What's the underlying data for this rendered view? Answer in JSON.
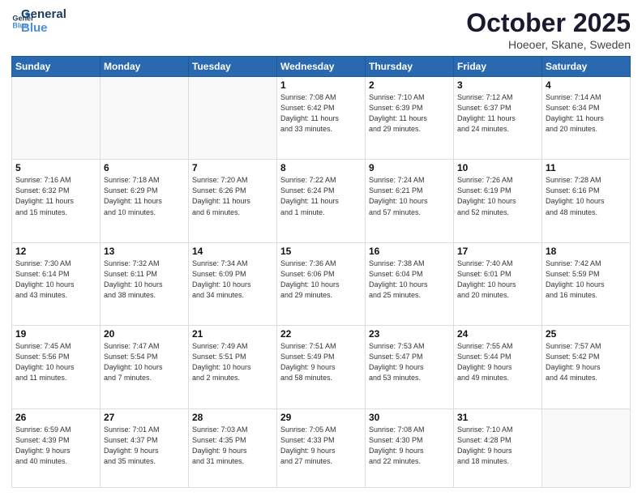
{
  "logo": {
    "line1": "General",
    "line2": "Blue"
  },
  "title": "October 2025",
  "subtitle": "Hoeoer, Skane, Sweden",
  "weekdays": [
    "Sunday",
    "Monday",
    "Tuesday",
    "Wednesday",
    "Thursday",
    "Friday",
    "Saturday"
  ],
  "weeks": [
    [
      {
        "day": "",
        "info": ""
      },
      {
        "day": "",
        "info": ""
      },
      {
        "day": "",
        "info": ""
      },
      {
        "day": "1",
        "info": "Sunrise: 7:08 AM\nSunset: 6:42 PM\nDaylight: 11 hours\nand 33 minutes."
      },
      {
        "day": "2",
        "info": "Sunrise: 7:10 AM\nSunset: 6:39 PM\nDaylight: 11 hours\nand 29 minutes."
      },
      {
        "day": "3",
        "info": "Sunrise: 7:12 AM\nSunset: 6:37 PM\nDaylight: 11 hours\nand 24 minutes."
      },
      {
        "day": "4",
        "info": "Sunrise: 7:14 AM\nSunset: 6:34 PM\nDaylight: 11 hours\nand 20 minutes."
      }
    ],
    [
      {
        "day": "5",
        "info": "Sunrise: 7:16 AM\nSunset: 6:32 PM\nDaylight: 11 hours\nand 15 minutes."
      },
      {
        "day": "6",
        "info": "Sunrise: 7:18 AM\nSunset: 6:29 PM\nDaylight: 11 hours\nand 10 minutes."
      },
      {
        "day": "7",
        "info": "Sunrise: 7:20 AM\nSunset: 6:26 PM\nDaylight: 11 hours\nand 6 minutes."
      },
      {
        "day": "8",
        "info": "Sunrise: 7:22 AM\nSunset: 6:24 PM\nDaylight: 11 hours\nand 1 minute."
      },
      {
        "day": "9",
        "info": "Sunrise: 7:24 AM\nSunset: 6:21 PM\nDaylight: 10 hours\nand 57 minutes."
      },
      {
        "day": "10",
        "info": "Sunrise: 7:26 AM\nSunset: 6:19 PM\nDaylight: 10 hours\nand 52 minutes."
      },
      {
        "day": "11",
        "info": "Sunrise: 7:28 AM\nSunset: 6:16 PM\nDaylight: 10 hours\nand 48 minutes."
      }
    ],
    [
      {
        "day": "12",
        "info": "Sunrise: 7:30 AM\nSunset: 6:14 PM\nDaylight: 10 hours\nand 43 minutes."
      },
      {
        "day": "13",
        "info": "Sunrise: 7:32 AM\nSunset: 6:11 PM\nDaylight: 10 hours\nand 38 minutes."
      },
      {
        "day": "14",
        "info": "Sunrise: 7:34 AM\nSunset: 6:09 PM\nDaylight: 10 hours\nand 34 minutes."
      },
      {
        "day": "15",
        "info": "Sunrise: 7:36 AM\nSunset: 6:06 PM\nDaylight: 10 hours\nand 29 minutes."
      },
      {
        "day": "16",
        "info": "Sunrise: 7:38 AM\nSunset: 6:04 PM\nDaylight: 10 hours\nand 25 minutes."
      },
      {
        "day": "17",
        "info": "Sunrise: 7:40 AM\nSunset: 6:01 PM\nDaylight: 10 hours\nand 20 minutes."
      },
      {
        "day": "18",
        "info": "Sunrise: 7:42 AM\nSunset: 5:59 PM\nDaylight: 10 hours\nand 16 minutes."
      }
    ],
    [
      {
        "day": "19",
        "info": "Sunrise: 7:45 AM\nSunset: 5:56 PM\nDaylight: 10 hours\nand 11 minutes."
      },
      {
        "day": "20",
        "info": "Sunrise: 7:47 AM\nSunset: 5:54 PM\nDaylight: 10 hours\nand 7 minutes."
      },
      {
        "day": "21",
        "info": "Sunrise: 7:49 AM\nSunset: 5:51 PM\nDaylight: 10 hours\nand 2 minutes."
      },
      {
        "day": "22",
        "info": "Sunrise: 7:51 AM\nSunset: 5:49 PM\nDaylight: 9 hours\nand 58 minutes."
      },
      {
        "day": "23",
        "info": "Sunrise: 7:53 AM\nSunset: 5:47 PM\nDaylight: 9 hours\nand 53 minutes."
      },
      {
        "day": "24",
        "info": "Sunrise: 7:55 AM\nSunset: 5:44 PM\nDaylight: 9 hours\nand 49 minutes."
      },
      {
        "day": "25",
        "info": "Sunrise: 7:57 AM\nSunset: 5:42 PM\nDaylight: 9 hours\nand 44 minutes."
      }
    ],
    [
      {
        "day": "26",
        "info": "Sunrise: 6:59 AM\nSunset: 4:39 PM\nDaylight: 9 hours\nand 40 minutes."
      },
      {
        "day": "27",
        "info": "Sunrise: 7:01 AM\nSunset: 4:37 PM\nDaylight: 9 hours\nand 35 minutes."
      },
      {
        "day": "28",
        "info": "Sunrise: 7:03 AM\nSunset: 4:35 PM\nDaylight: 9 hours\nand 31 minutes."
      },
      {
        "day": "29",
        "info": "Sunrise: 7:05 AM\nSunset: 4:33 PM\nDaylight: 9 hours\nand 27 minutes."
      },
      {
        "day": "30",
        "info": "Sunrise: 7:08 AM\nSunset: 4:30 PM\nDaylight: 9 hours\nand 22 minutes."
      },
      {
        "day": "31",
        "info": "Sunrise: 7:10 AM\nSunset: 4:28 PM\nDaylight: 9 hours\nand 18 minutes."
      },
      {
        "day": "",
        "info": ""
      }
    ]
  ]
}
